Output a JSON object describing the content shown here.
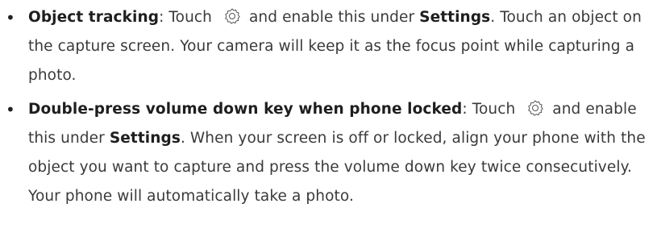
{
  "items": [
    {
      "term": "Object tracking",
      "sep": ": Touch ",
      "icon": "settings-gear-icon",
      "t1": " and enable this under ",
      "bold1": "Settings",
      "t2": ". Touch an object on the capture screen. Your camera will keep it as the focus point while capturing a photo."
    },
    {
      "term": "Double-press volume down key when phone locked",
      "sep": ": Touch ",
      "icon": "settings-gear-icon",
      "t1": " and enable this under ",
      "bold1": "Settings",
      "t2": ". When your screen is off or locked, align your phone with the object you want to capture and press the volume down key twice consecutively. Your phone will automatically take a photo."
    }
  ]
}
